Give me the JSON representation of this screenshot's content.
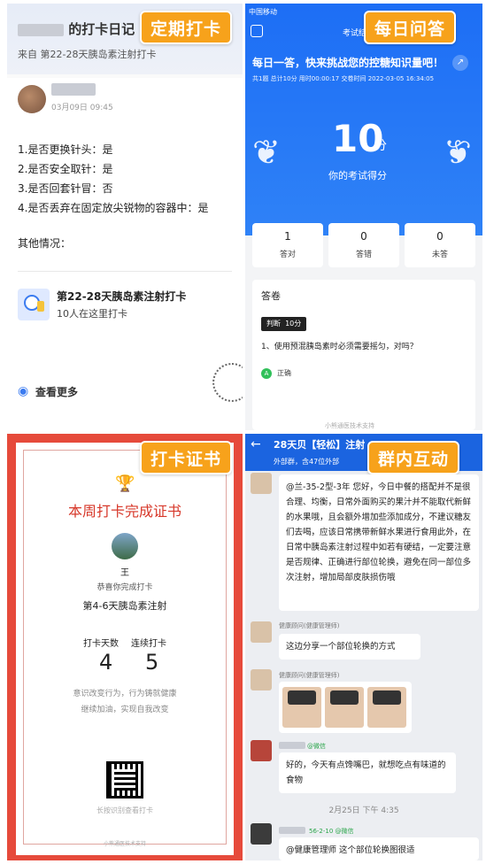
{
  "panel1": {
    "tag": "定期打卡",
    "title": "的打卡日记",
    "subtitle": "来自 第22-28天胰岛素注射打卡",
    "date": "03月09日 09:45",
    "questions": [
      "1.是否更换针头：是",
      "2.是否安全取针：是",
      "3.是否回套针冒：否",
      "4.是否丢弃在固定放尖锐物的容器中：是"
    ],
    "other": "其他情况：",
    "group_title": "第22-28天胰岛素注射打卡",
    "group_sub": "10人在这里打卡",
    "more": "查看更多"
  },
  "panel2": {
    "tag": "每日问答",
    "status_carrier": "中国移动",
    "app_title": "考试结",
    "headline": "每日一答，快来挑战您的控糖知识量吧！",
    "meta": "共1题   总计10分   用时00:00:17   交卷时间 2022-03-05 16:34:05",
    "score": "10",
    "score_unit": "分",
    "score_label": "你的考试得分",
    "stats": [
      {
        "value": "1",
        "label": "答对"
      },
      {
        "value": "0",
        "label": "答错"
      },
      {
        "value": "0",
        "label": "未答"
      }
    ],
    "answer_header": "答卷",
    "q_type": "判断",
    "q_points": "10分",
    "question": "1、使用预混胰岛素时必须需要摇匀，对吗？",
    "option_letter": "A",
    "option": "正确",
    "footer": "小熊通医技术支持"
  },
  "panel3": {
    "tag": "打卡证书",
    "title": "本周打卡完成证书",
    "name": "王",
    "congrats": "恭喜你完成打卡",
    "period": "第4-6天胰岛素注射",
    "days_label": "打卡天数",
    "streak_label": "连续打卡",
    "days": "4",
    "streak": "5",
    "motto1": "意识改变行为，行为铸就健康",
    "motto2": "继续加油，实现自我改变",
    "scan": "长按识别查看打卡",
    "footer": "小熊通医技术支持"
  },
  "panel4": {
    "tag": "群内互动",
    "title": "28天贝【轻松】注射",
    "subtitle": "外部群，含47位外部",
    "msg1_sender": "@兰-35-2型-3年",
    "msg1": "@兰-35-2型-3年 您好，今日中餐的搭配并不是很合理、均衡，日常外面购买的果汁并不能取代新鲜的水果哦，且会额外增加些添加成分，不建议糖友们去喝，应该日常携带新鲜水果进行食用此外，在日常中胰岛素注射过程中如若有硬结，一定要注意是否规律、正确进行部位轮换，避免在同一部位多次注射，增加局部皮肤损伤哦",
    "advisor": "健康顾问(健康管理师)",
    "msg2": "这边分享一个部位轮换的方式",
    "advisor2": "健康顾问(健康管理师)",
    "wechat1": "@微信",
    "msg3": "好的，今天有点馋嘴巴，就想吃点有味道的食物",
    "time": "2月25日 下午 4:35",
    "wechat2": "56-2-10 @微信",
    "msg4": "@健康管理师  这个部位轮换图很适"
  }
}
